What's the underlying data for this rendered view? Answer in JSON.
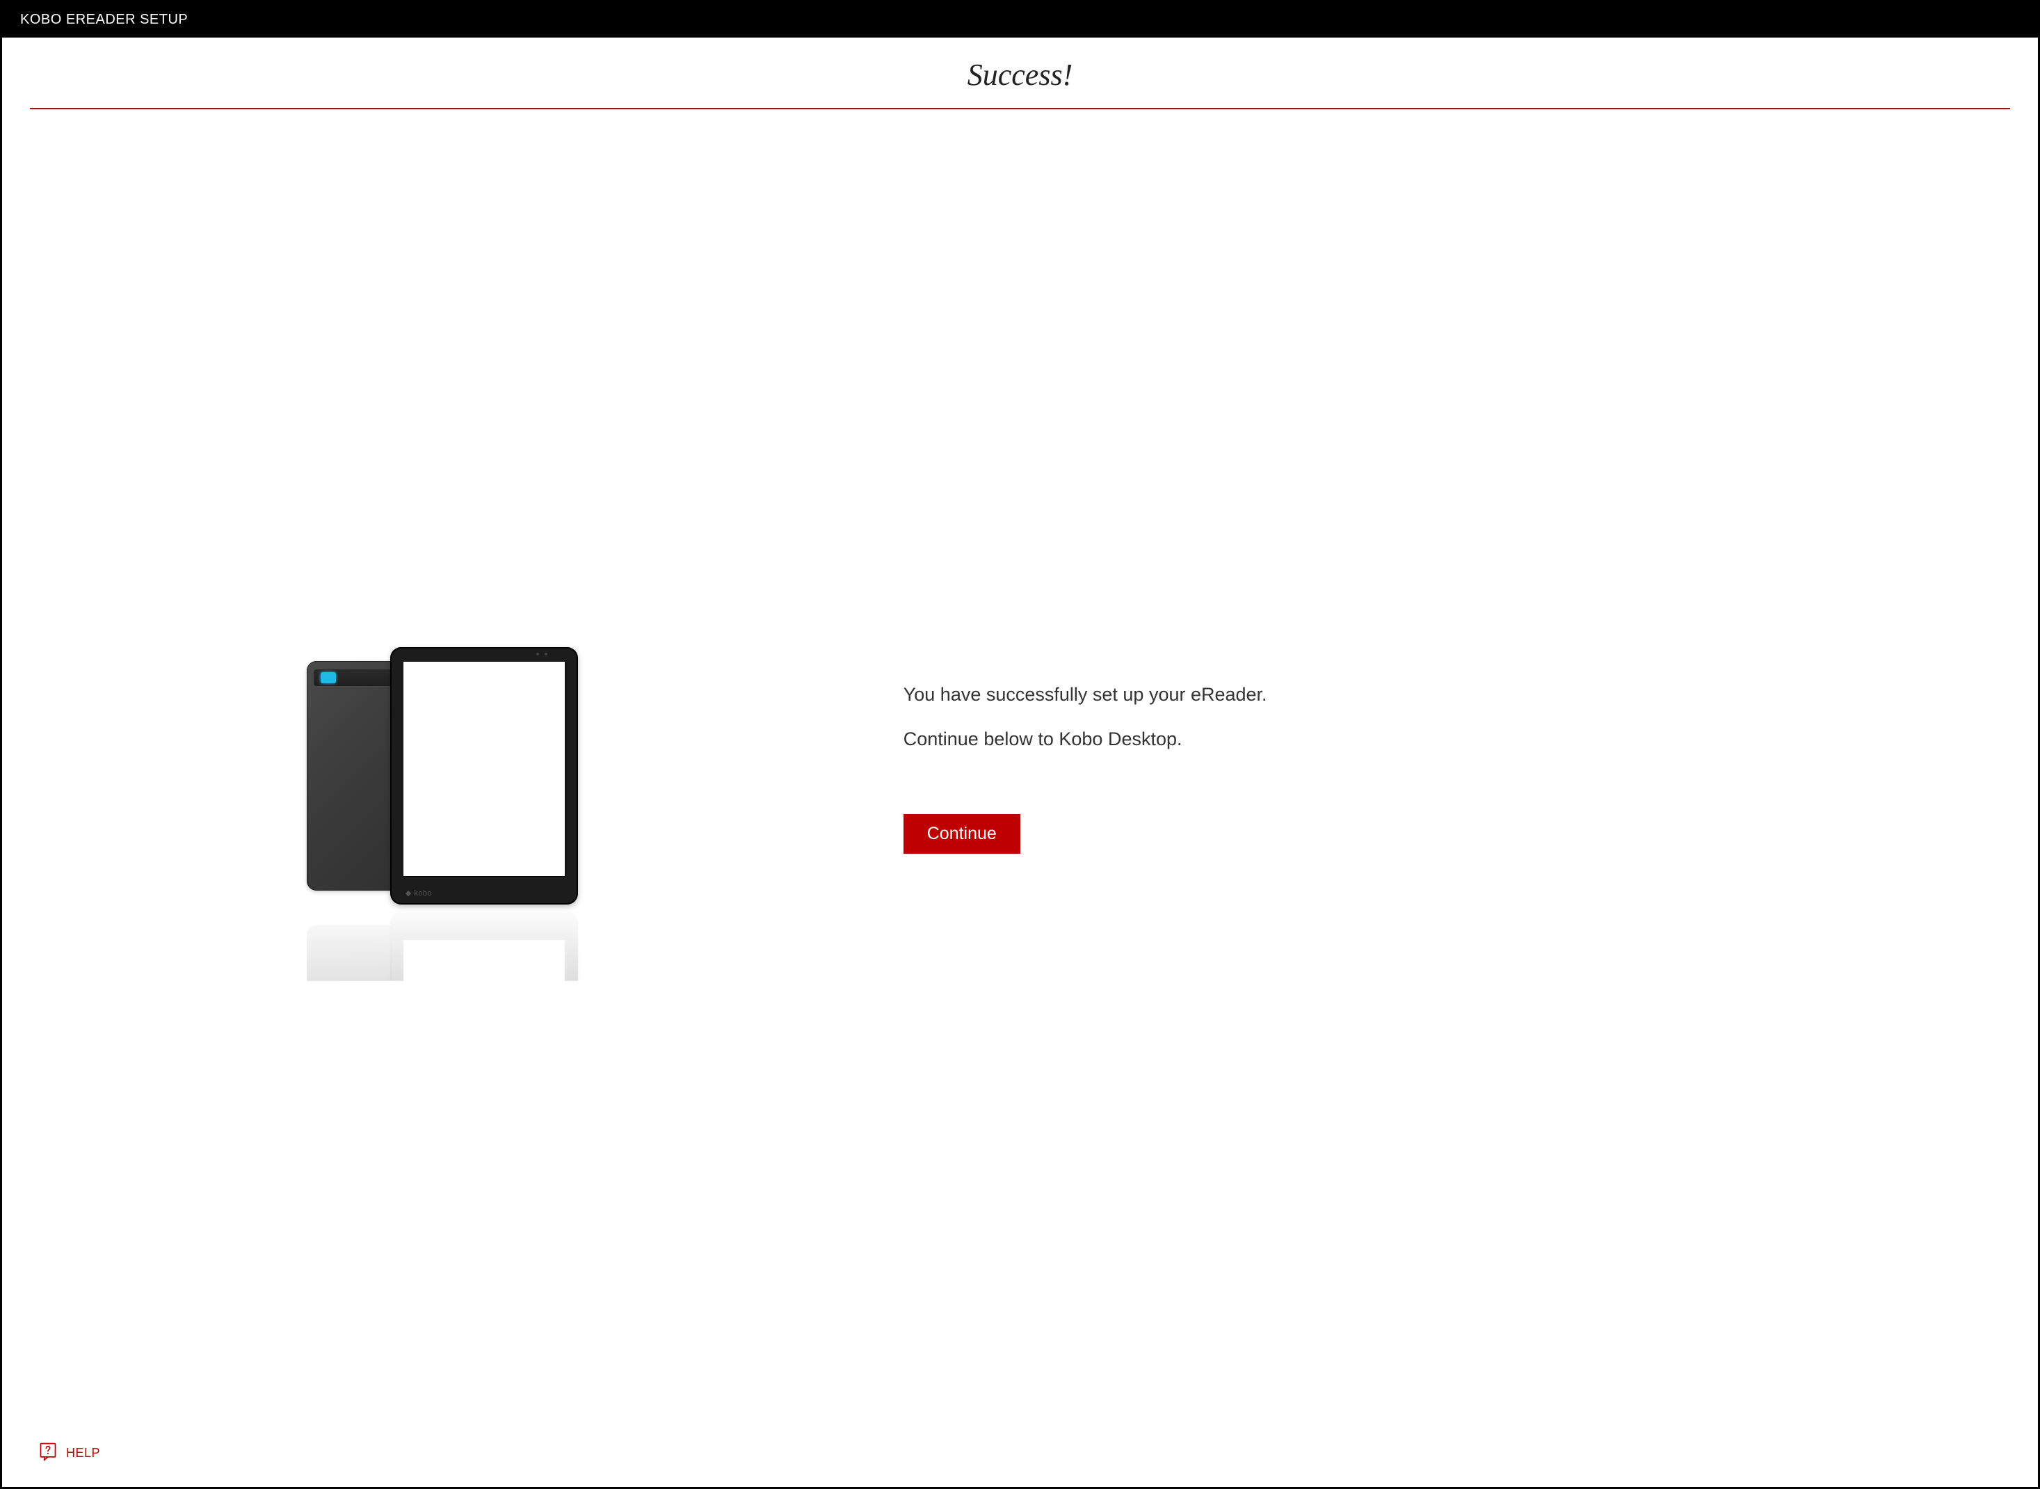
{
  "window": {
    "title": "KOBO EREADER SETUP"
  },
  "main": {
    "heading": "Success!",
    "line1": "You have successfully set up your eReader.",
    "line2": "Continue below to Kobo Desktop.",
    "continue_label": "Continue",
    "device_brand": "kobo"
  },
  "footer": {
    "help_label": "HELP"
  },
  "colors": {
    "accent": "#BF0000"
  }
}
